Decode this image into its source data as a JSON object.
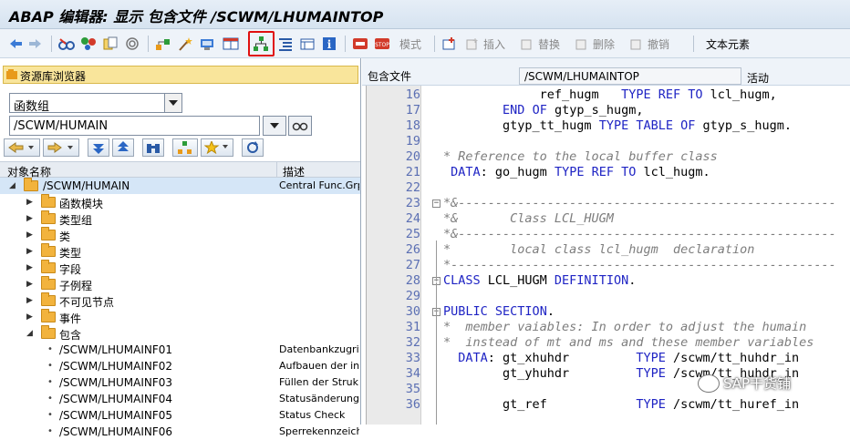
{
  "window": {
    "title": "ABAP 编辑器: 显示 包含文件 /SCWM/LHUMAINTOP"
  },
  "toolbar": {
    "labels": {
      "pattern": "模式",
      "insert": "插入",
      "replace": "替换",
      "delete": "删除",
      "undo": "撤销",
      "text_elements": "文本元素"
    },
    "icons": [
      "back-arrow-icon",
      "forward-arrow-icon",
      "glasses-icon",
      "objects-icon",
      "copy-icon",
      "spiral-icon",
      "hierarchy-icon",
      "magic-wand-icon",
      "transport-icon",
      "window-split-icon",
      "object-list-icon",
      "indent-icon",
      "display-icon",
      "info-icon",
      "stop-icon",
      "stop-list-icon",
      "add-row-icon"
    ]
  },
  "repository": {
    "title": "资源库浏览器",
    "object_type": "函数组",
    "object_name": "/SCWM/HUMAIN",
    "columns": {
      "name": "对象名称",
      "desc": "描述"
    },
    "root": {
      "label": "/SCWM/HUMAIN",
      "desc": "Central Func.Grp"
    },
    "folders": [
      "函数模块",
      "类型组",
      "类",
      "类型",
      "字段",
      "子例程",
      "不可见节点",
      "事件",
      "包含"
    ],
    "includes": [
      {
        "label": "/SCWM/LHUMAINF01",
        "desc": "Datenbankzugriff"
      },
      {
        "label": "/SCWM/LHUMAINF02",
        "desc": "Aufbauen der in"
      },
      {
        "label": "/SCWM/LHUMAINF03",
        "desc": "Füllen der Struk"
      },
      {
        "label": "/SCWM/LHUMAINF04",
        "desc": "Statusänderung"
      },
      {
        "label": "/SCWM/LHUMAINF05",
        "desc": "Status Check"
      },
      {
        "label": "/SCWM/LHUMAINF06",
        "desc": "Sperrekennzeich"
      }
    ]
  },
  "editor_header": {
    "label": "包含文件",
    "include_name": "/SCWM/LHUMAINTOP",
    "status": "活动"
  },
  "editor": {
    "lines": [
      {
        "n": "16",
        "t": "             ref_hugm   TYPE REF TO lcl_hugm,"
      },
      {
        "n": "17",
        "t": "        END OF gtyp_s_hugm,"
      },
      {
        "n": "18",
        "t": "        gtyp_tt_hugm TYPE TABLE OF gtyp_s_hugm."
      },
      {
        "n": "19",
        "t": ""
      },
      {
        "n": "20",
        "t": "* Reference to the local buffer class"
      },
      {
        "n": "21",
        "t": " DATA: go_hugm TYPE REF TO lcl_hugm."
      },
      {
        "n": "22",
        "t": ""
      },
      {
        "n": "23",
        "t": "*&---------------------------------------------------"
      },
      {
        "n": "24",
        "t": "*&       Class LCL_HUGM"
      },
      {
        "n": "25",
        "t": "*&---------------------------------------------------"
      },
      {
        "n": "26",
        "t": "*        local class lcl_hugm  declaration"
      },
      {
        "n": "27",
        "t": "*----------------------------------------------------"
      },
      {
        "n": "28",
        "t": "CLASS LCL_HUGM DEFINITION."
      },
      {
        "n": "29",
        "t": ""
      },
      {
        "n": "30",
        "t": "PUBLIC SECTION."
      },
      {
        "n": "31",
        "t": "*  member vaiables: In order to adjust the humain"
      },
      {
        "n": "32",
        "t": "*  instead of mt and ms and these member variables"
      },
      {
        "n": "33",
        "t": "  DATA: gt_xhuhdr         TYPE /scwm/tt_huhdr_in"
      },
      {
        "n": "34",
        "t": "        gt_yhuhdr         TYPE /scwm/tt_huhdr_in"
      },
      {
        "n": "35",
        "t": ""
      },
      {
        "n": "36",
        "t": "        gt_ref            TYPE /scwm/tt_huref_in"
      }
    ]
  },
  "watermark": {
    "text": "SAP干货铺"
  }
}
